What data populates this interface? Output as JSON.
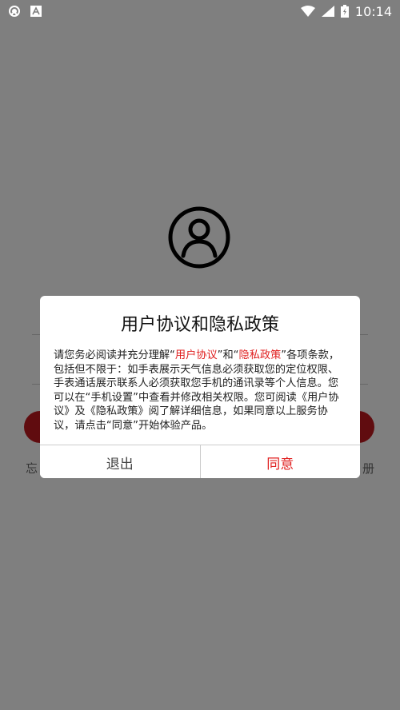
{
  "status_bar": {
    "time": "10:14",
    "icons": [
      "sync-icon",
      "a-badge-icon",
      "wifi-icon",
      "signal-icon",
      "battery-icon"
    ]
  },
  "login": {
    "login_label": "",
    "forgot_label": "忘",
    "register_label": "册"
  },
  "dialog": {
    "title": "用户协议和隐私政策",
    "body": {
      "p1": "请您务必阅读并充分理解“",
      "link_user_agreement": "用户协议",
      "p2": "”和“",
      "link_privacy_policy": "隐私政策",
      "p3": "”各项条款，包括但不限于：如手表展示天气信息必须获取您的定位权限、手表通话展示联系人必须获取您手机的通讯录等个人信息。您可以在“手机设置”中查看并修改相关权限。您可阅读《用户协议》及《隐私政策》阅了解详细信息，如果同意以上服务协议，请点击“同意”开始体验产品。"
    },
    "exit_label": "退出",
    "agree_label": "同意"
  },
  "colors": {
    "accent_red": "#e02020",
    "button_red": "#c0191e",
    "overlay": "rgba(0,0,0,0.5)"
  }
}
